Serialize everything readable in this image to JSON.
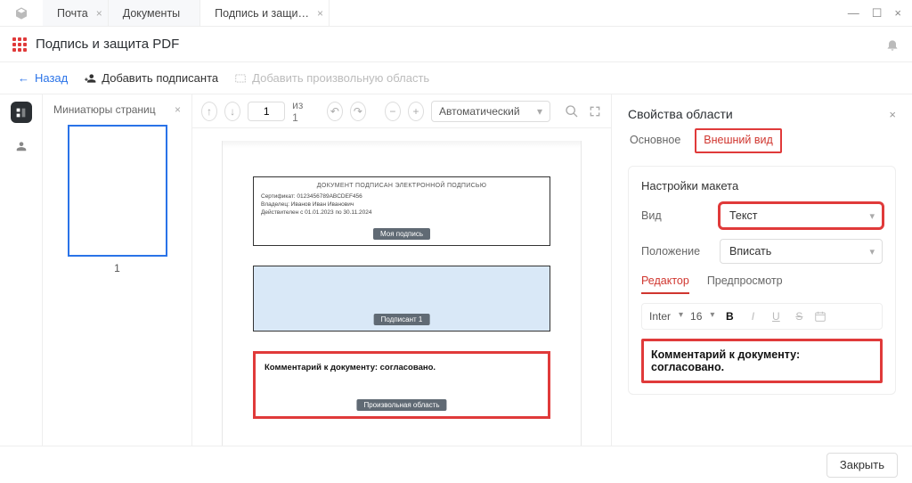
{
  "tabs": [
    {
      "label": "Почта"
    },
    {
      "label": "Документы"
    },
    {
      "label": "Подпись и защи…"
    }
  ],
  "header": {
    "title": "Подпись и защита PDF"
  },
  "actions": {
    "back": "Назад",
    "add_signer": "Добавить подписанта",
    "add_area": "Добавить произвольную область"
  },
  "thumbs": {
    "title": "Миниатюры страниц",
    "page_num": "1"
  },
  "doc_toolbar": {
    "page_value": "1",
    "page_of": "из 1",
    "zoom": "Автоматический"
  },
  "page_fields": {
    "sig1": {
      "title": "ДОКУМЕНТ ПОДПИСАН ЭЛЕКТРОННОЙ ПОДПИСЬЮ",
      "line1": "Сертификат: 0123456789ABCDEF456",
      "line2": "Владелец: Иванов Иван Иванович",
      "line3": "Действителен с 01.01.2023 по 30.11.2024",
      "chip": "Моя подпись"
    },
    "sig2": {
      "chip": "Подписант 1"
    },
    "custom": {
      "text": "Комментарий к документу: согласовано.",
      "chip": "Произвольная область"
    }
  },
  "right": {
    "title": "Свойства области",
    "tabs": {
      "main": "Основное",
      "appearance": "Внешний вид"
    },
    "layout_title": "Настройки макета",
    "form": {
      "kind_label": "Вид",
      "kind_value": "Текст",
      "pos_label": "Положение",
      "pos_value": "Вписать"
    },
    "subtabs": {
      "editor": "Редактор",
      "preview": "Предпросмотр"
    },
    "editor_tb": {
      "font": "Inter",
      "size": "16"
    },
    "editor_text": "Комментарий к документу: согласовано."
  },
  "footer": {
    "close": "Закрыть"
  }
}
